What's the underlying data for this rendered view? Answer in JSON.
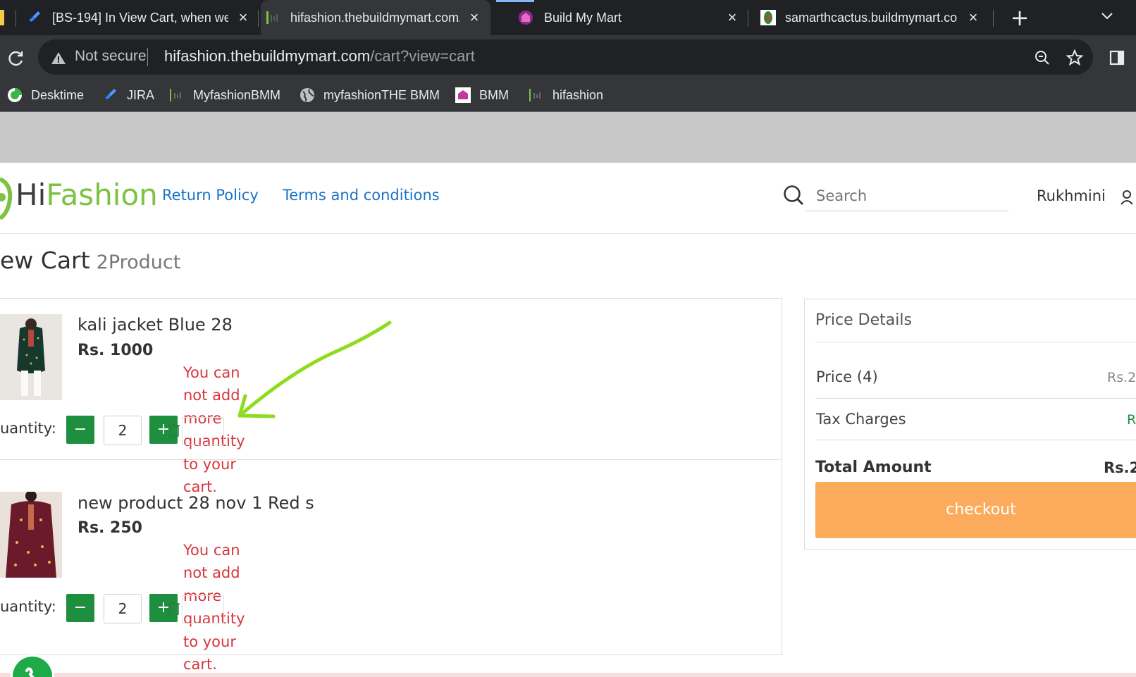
{
  "browser": {
    "tabs": [
      {
        "title": "[BS-194] In View Cart, when we",
        "icon": "jira-icon"
      },
      {
        "title": "hifashion.thebuildmymart.com/",
        "icon": "hifashion-favicon",
        "active": true
      },
      {
        "title": "Build My Mart",
        "icon": "buildmymart-favicon"
      },
      {
        "title": "samarthcactus.buildmymart.co",
        "icon": "cactus-favicon"
      }
    ],
    "new_tab": "+",
    "security": "Not secure",
    "url_host": "hifashion.thebuildmymart.com",
    "url_path": "/cart?view=cart",
    "bookmarks": [
      {
        "label": "Desktime",
        "icon": "desktime-icon"
      },
      {
        "label": "JIRA",
        "icon": "jira-icon"
      },
      {
        "label": "MyfashionBMM",
        "icon": "hifashion-favicon"
      },
      {
        "label": "myfashionTHE BMM",
        "icon": "globe-icon"
      },
      {
        "label": "BMM",
        "icon": "bmm-icon"
      },
      {
        "label": "hifashion",
        "icon": "hifashion-favicon"
      }
    ]
  },
  "site": {
    "logo_hi": "Hi",
    "logo_fashion": "Fashion",
    "nav": [
      "Return Policy",
      "Terms and conditions"
    ],
    "search_placeholder": "Search",
    "user": "Rukhmini"
  },
  "cart": {
    "title": "ew Cart",
    "count": "2Product",
    "items": [
      {
        "name": "kali jacket Blue 28",
        "price": "Rs. 1000",
        "qty_label": "uantity:",
        "qty": "2",
        "error": "You can not add more quantity to your cart."
      },
      {
        "name": "new product 28 nov 1 Red s",
        "price": "Rs. 250",
        "qty_label": "uantity:",
        "qty": "2",
        "error": "You can not add more quantity to your cart."
      }
    ],
    "minus": "−",
    "plus": "+"
  },
  "price_details": {
    "title": "Price Details",
    "rows": [
      {
        "label": "Price (4)",
        "value": "Rs.2"
      },
      {
        "label": "Tax Charges",
        "value": "R"
      }
    ],
    "total_label": "Total Amount",
    "total_value": "Rs.2",
    "checkout": "checkout"
  },
  "colors": {
    "accent_green": "#1e8f3e",
    "error_red": "#d8343c",
    "link_blue": "#1a73c8",
    "checkout_orange": "#fcab5d",
    "annotation_green": "#8fdc1e",
    "logo_green": "#7cc243"
  }
}
